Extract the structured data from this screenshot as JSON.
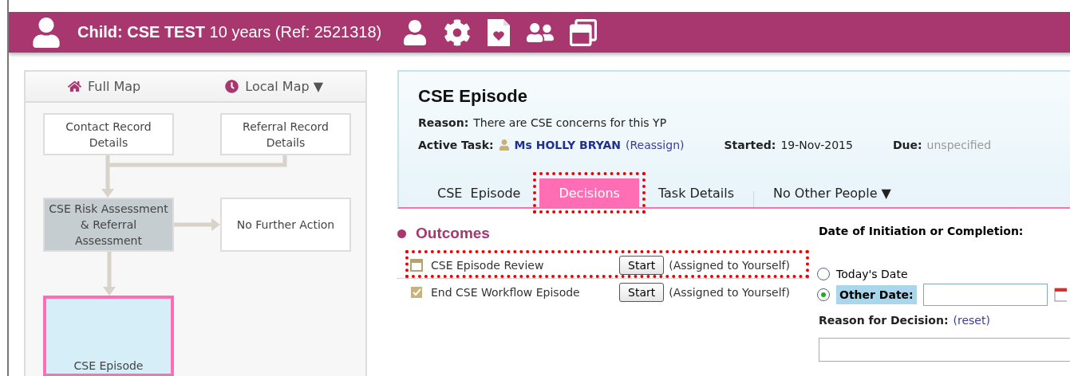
{
  "header": {
    "label": "Child:",
    "name": "CSE TEST",
    "details": "10 years (Ref: 2521318)"
  },
  "map": {
    "nav": [
      {
        "label": "Full Map",
        "kind": "home"
      },
      {
        "label": "Local Map ▼",
        "kind": "clock"
      }
    ],
    "nodes": [
      {
        "label": "Contact Record Details",
        "completed": false,
        "selected": false
      },
      {
        "label": "Referral Record Details",
        "completed": false,
        "selected": false
      },
      {
        "label": "CSE Risk Assessment & Referral Assessment",
        "completed": true,
        "selected": false
      },
      {
        "label": "No Further Action",
        "completed": false,
        "selected": false
      },
      {
        "label": "CSE Episode",
        "completed": false,
        "selected": true
      }
    ]
  },
  "episode": {
    "title": "CSE Episode",
    "reason_label": "Reason:",
    "reason": "There are CSE concerns for this YP",
    "task_label": "Active Task:",
    "task_person": "Ms HOLLY BRYAN",
    "reassign": "(Reassign)",
    "started_label": "Started:",
    "started": "19-Nov-2015",
    "due_label": "Due:",
    "due": "unspecified"
  },
  "tabs": [
    {
      "label": "CSE  Episode",
      "selected": false,
      "highlighted": false
    },
    {
      "label": "Decisions",
      "selected": true,
      "highlighted": true
    },
    {
      "label": "Task Details",
      "selected": false,
      "highlighted": false
    },
    {
      "label": "No Other People ▼",
      "selected": false,
      "highlighted": false
    }
  ],
  "outcomes": {
    "title": "Outcomes",
    "items": [
      {
        "label": "CSE Episode Review",
        "button": "Start",
        "note": "(Assigned to Yourself)",
        "kind": "review",
        "highlighted": true
      },
      {
        "label": "End CSE Workflow Episode",
        "button": "Start",
        "note": "(Assigned to Yourself)",
        "kind": "end",
        "highlighted": false
      }
    ]
  },
  "decision": {
    "date_label": "Date of Initiation or Completion:",
    "options": [
      {
        "label": "Today's Date",
        "selected": false
      },
      {
        "label": "Other Date:",
        "selected": true
      }
    ],
    "reason_label": "Reason for Decision:",
    "reset": "(reset)"
  }
}
